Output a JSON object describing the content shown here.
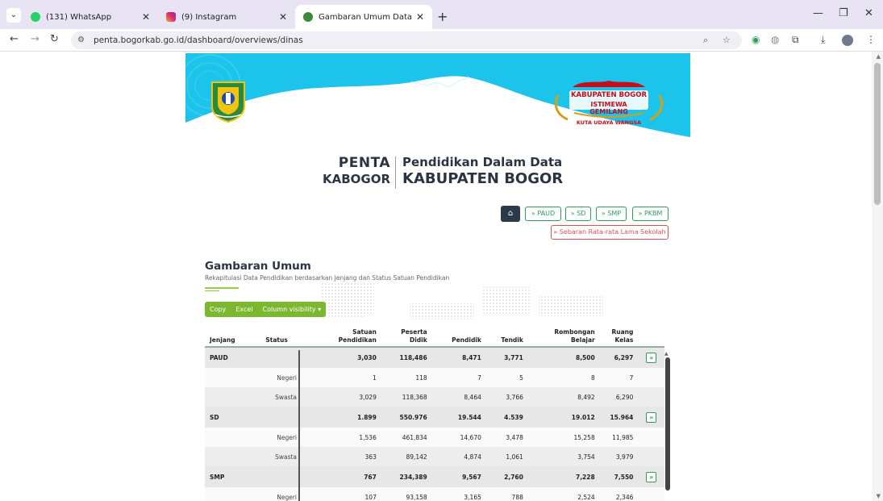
{
  "browser": {
    "tabs": [
      {
        "title": "(131) WhatsApp",
        "favicon_color": "#25d366",
        "active": false
      },
      {
        "title": "(9) Instagram",
        "favicon_color": "#e1306c",
        "active": false
      },
      {
        "title": "Gambaran Umum Data Pendidik",
        "favicon_color": "#3a8a3a",
        "active": true
      }
    ],
    "url": "penta.bogorkab.go.id/dashboard/overviews/dinas"
  },
  "banner": {
    "right_logo_main": "KABUPATEN BOGOR",
    "right_logo_sub": "ISTIMEWA GEMILANG",
    "right_logo_tag": "KUTA UDAYA WANGSA"
  },
  "brand": {
    "left_top": "PENTA",
    "left_bottom": "KABOGOR",
    "right_top": "Pendidikan Dalam Data",
    "right_bottom": "KABUPATEN BOGOR"
  },
  "nav": {
    "home_icon": "home-icon",
    "jenjang": [
      "» PAUD",
      "» SD",
      "» SMP",
      "» PKBM"
    ],
    "rata_rata": "» Sebaran Rata-rata Lama Sekolah"
  },
  "section": {
    "title": "Gambaran Umum",
    "subtitle": "Rekapitulasi Data Pendidikan berdasarkan Jenjang dan Status Satuan Pendidikan"
  },
  "table_buttons": {
    "copy": "Copy",
    "excel": "Excel",
    "column_visibility": "Column visibility ▾"
  },
  "table": {
    "headers": [
      "Jenjang",
      "Status",
      "Satuan Pendidikan",
      "Peserta Didik",
      "Pendidik",
      "Tendik",
      "Rombongan Belajar",
      "Ruang Kelas"
    ],
    "rows": [
      {
        "type": "group",
        "cells": [
          "PAUD",
          "",
          "3,030",
          "118,486",
          "8,471",
          "3,771",
          "8,500",
          "6,297"
        ],
        "expand": "»"
      },
      {
        "type": "sub1",
        "cells": [
          "",
          "Negeri",
          "1",
          "118",
          "7",
          "5",
          "8",
          "7"
        ]
      },
      {
        "type": "sub2",
        "cells": [
          "",
          "Swasta",
          "3,029",
          "118,368",
          "8,464",
          "3,766",
          "8,492",
          "6,290"
        ]
      },
      {
        "type": "group",
        "cells": [
          "SD",
          "",
          "1.899",
          "550.976",
          "19.544",
          "4.539",
          "19.012",
          "15.964"
        ],
        "expand": "»"
      },
      {
        "type": "sub1",
        "cells": [
          "",
          "Negeri",
          "1,536",
          "461,834",
          "14,670",
          "3,478",
          "15,258",
          "11,985"
        ]
      },
      {
        "type": "sub2",
        "cells": [
          "",
          "Swasta",
          "363",
          "89,142",
          "4,874",
          "1,061",
          "3,754",
          "3,979"
        ]
      },
      {
        "type": "group",
        "cells": [
          "SMP",
          "",
          "767",
          "234,389",
          "9,567",
          "2,760",
          "7,228",
          "7,550"
        ],
        "expand": "»"
      },
      {
        "type": "sub1",
        "cells": [
          "",
          "Negeri",
          "107",
          "93,158",
          "3,165",
          "788",
          "2,524",
          "2,346"
        ]
      }
    ]
  },
  "colors": {
    "banner": "#1cc3ea",
    "accent_green": "#7cb82f",
    "button_green": "#2e9c5c",
    "button_red": "#d9534f",
    "dark_text": "#2b3442"
  }
}
